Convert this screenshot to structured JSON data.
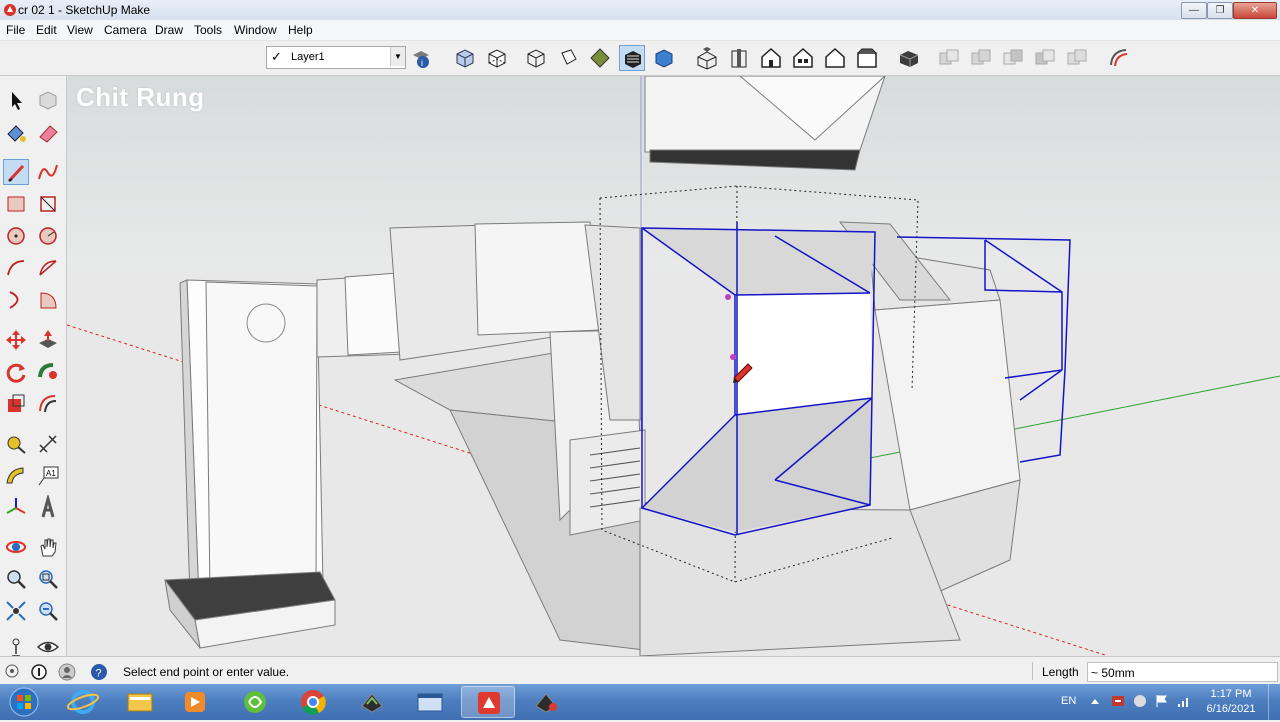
{
  "window": {
    "title": "cr 02 1 - SketchUp Make",
    "controls": [
      "minimize",
      "maximize",
      "close"
    ]
  },
  "menu": [
    "File",
    "Edit",
    "View",
    "Camera",
    "Draw",
    "Tools",
    "Window",
    "Help"
  ],
  "toolbar": {
    "layer_name": "Layer1",
    "icons": [
      "layer-manager-icon",
      "xray-icon",
      "back-edges-icon",
      "wireframe-icon",
      "hidden-line-icon",
      "shaded-icon",
      "shaded-textures-icon",
      "monochrome-icon",
      "iso-view-icon",
      "top-view-icon",
      "front-view-icon",
      "right-view-icon",
      "back-view-icon",
      "left-view-icon",
      "outer-shell-icon",
      "intersect-icon",
      "union-icon",
      "subtract-icon",
      "trim-icon",
      "split-icon",
      "soften-edges-icon"
    ],
    "active_icon": "shaded-textures-icon"
  },
  "palette": {
    "tools": [
      "select",
      "make-component",
      "paint-bucket",
      "eraser",
      "line",
      "freehand",
      "rectangle",
      "rotated-rectangle",
      "circle",
      "polygon",
      "arc",
      "two-point-arc",
      "three-point-arc",
      "pie",
      "move",
      "push-pull",
      "rotate",
      "follow-me",
      "scale",
      "offset",
      "tape-measure",
      "dimension",
      "protractor",
      "text",
      "axes",
      "3d-text",
      "orbit",
      "pan",
      "zoom",
      "zoom-window",
      "zoom-extents",
      "previous-view",
      "position-camera",
      "look-around"
    ],
    "active_tool": "line"
  },
  "viewport": {
    "watermark": "Chit Rung",
    "axis_colors": {
      "red": "#d9241f",
      "green": "#2aa52a",
      "blue": "#1c1cc8"
    },
    "selection_color": "#1414c8"
  },
  "status": {
    "message": "Select end point or enter value.",
    "length_label": "Length",
    "length_value": "~ 50mm"
  },
  "taskbar": {
    "apps": [
      "start",
      "internet-explorer",
      "file-explorer",
      "media-player",
      "app-green",
      "chrome",
      "app-dark",
      "window-manager",
      "sketchup-app",
      "app-cad"
    ],
    "language": "EN",
    "time": "1:17 PM",
    "date": "6/16/2021"
  }
}
